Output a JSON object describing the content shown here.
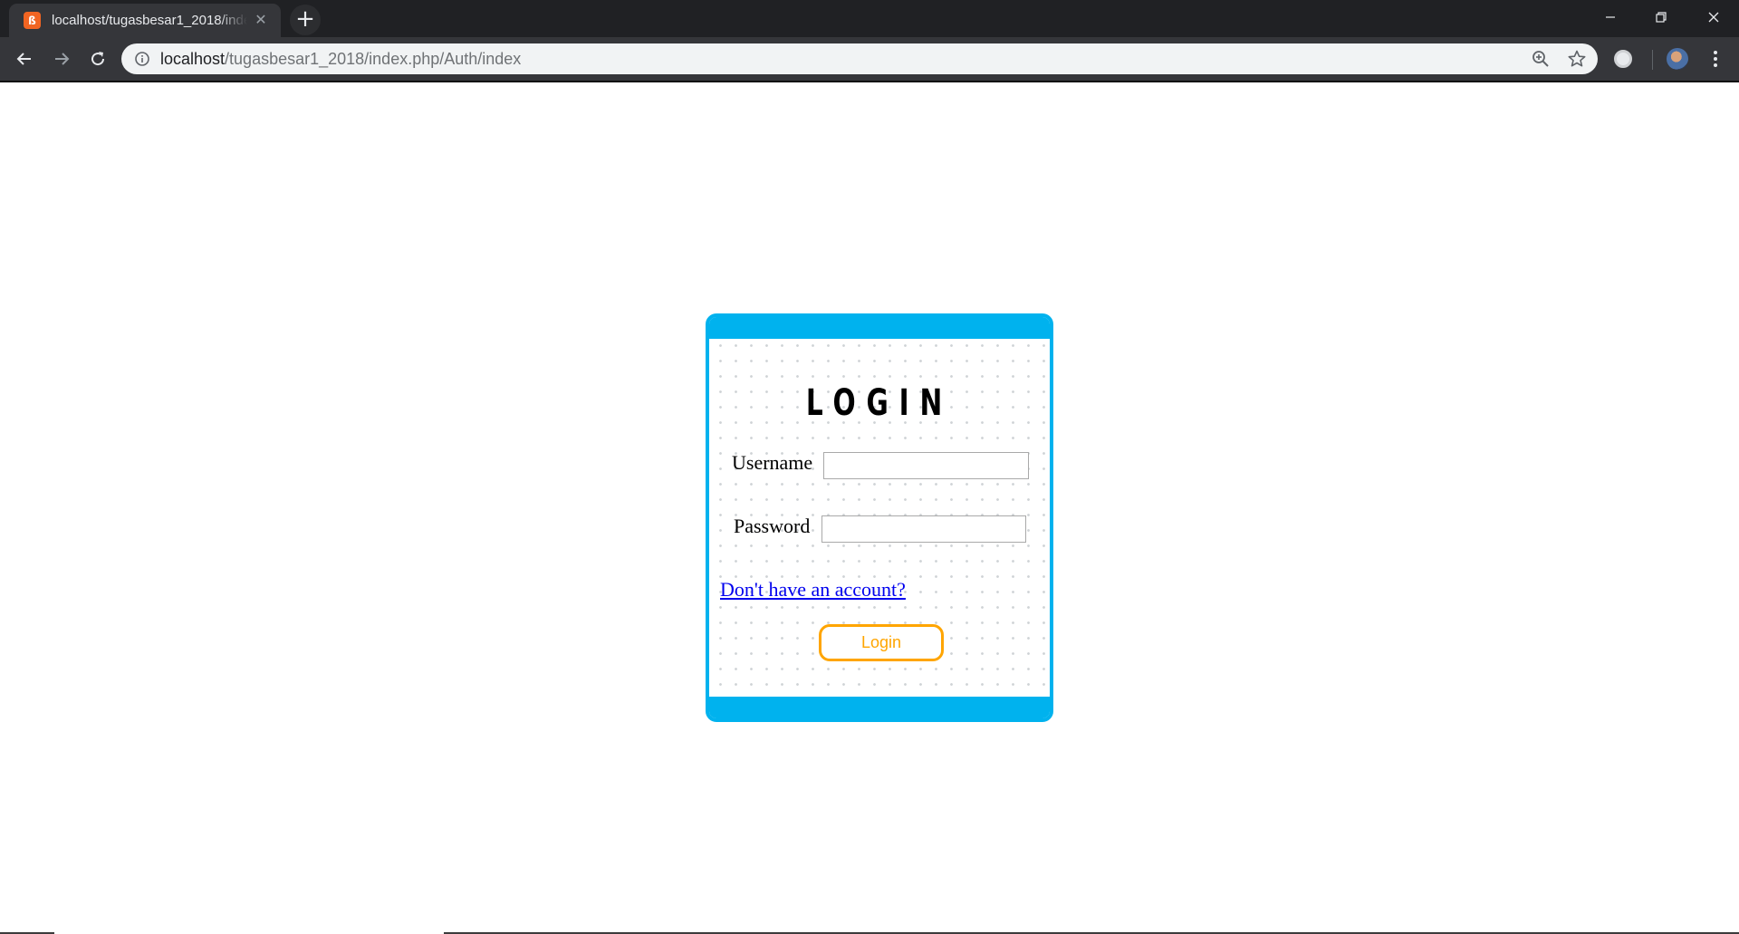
{
  "browser": {
    "tab_title": "localhost/tugasbesar1_2018/index.php/Auth/index",
    "tab_favicon_glyph": "ß",
    "close_glyph": "✕",
    "new_tab_glyph": "+",
    "url_host": "localhost",
    "url_path": "/tugasbesar1_2018/index.php/Auth/index",
    "icons": [
      "back-icon",
      "forward-icon",
      "reload-icon",
      "info-icon",
      "zoom-icon",
      "star-icon",
      "extension-icon",
      "avatar",
      "menu-icon",
      "minimize-icon",
      "maximize-icon",
      "close-icon"
    ]
  },
  "login": {
    "title": "LOGIN",
    "username_label": "Username",
    "username_value": "",
    "password_label": "Password",
    "password_value": "",
    "register_link": "Don't have an account?",
    "submit_label": "Login"
  },
  "colors": {
    "accent_blue": "#00b2ee",
    "button_orange": "#ffa500",
    "link_blue": "#0000ee"
  }
}
